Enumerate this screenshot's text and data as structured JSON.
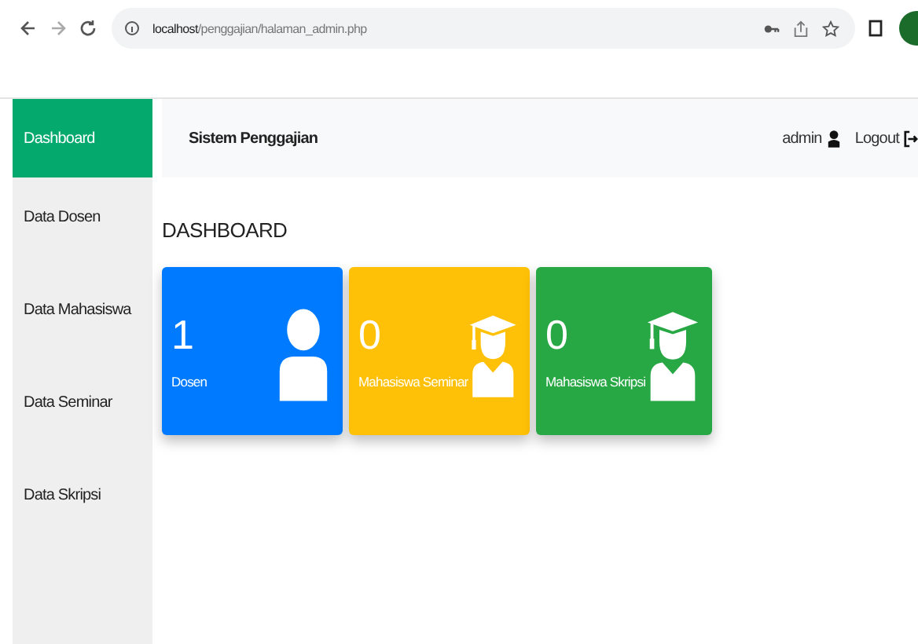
{
  "browser": {
    "url_host": "localhost",
    "url_path": "/penggajian/halaman_admin.php"
  },
  "sidebar": {
    "items": [
      {
        "label": "Dashboard",
        "selected": true
      },
      {
        "label": "Data Dosen",
        "selected": false
      },
      {
        "label": "Data Mahasiswa",
        "selected": false
      },
      {
        "label": "Data Seminar",
        "selected": false
      },
      {
        "label": "Data Skripsi",
        "selected": false
      }
    ]
  },
  "navbar": {
    "title": "Sistem Penggajian",
    "user": "admin",
    "logout": "Logout"
  },
  "heading": "DASHBOARD",
  "cards": [
    {
      "count": "1",
      "label": "Dosen",
      "color": "#007bff",
      "kind": "person"
    },
    {
      "count": "0",
      "label": "Mahasiswa Seminar",
      "color": "#ffc107",
      "kind": "graduate"
    },
    {
      "count": "0",
      "label": "Mahasiswa Skripsi",
      "color": "#28a745",
      "kind": "graduate"
    }
  ]
}
